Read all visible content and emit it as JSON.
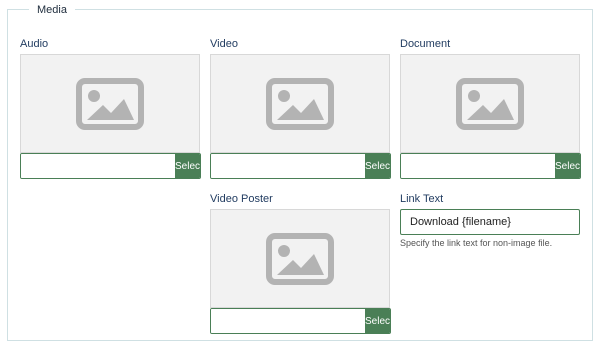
{
  "fieldset": {
    "legend": "Media"
  },
  "fields": {
    "audio": {
      "label": "Audio",
      "value": "",
      "button": "Select",
      "preview_icon": "image-placeholder-icon"
    },
    "video": {
      "label": "Video",
      "value": "",
      "button": "Select",
      "preview_icon": "image-placeholder-icon"
    },
    "document": {
      "label": "Document",
      "value": "",
      "button": "Select",
      "preview_icon": "image-placeholder-icon"
    },
    "video_poster": {
      "label": "Video Poster",
      "value": "",
      "button": "Select",
      "preview_icon": "image-placeholder-icon"
    },
    "link_text": {
      "label": "Link Text",
      "value": "Download {filename}",
      "help": "Specify the link text for non-image file."
    }
  },
  "colors": {
    "accent": "#4a7f56",
    "fieldset_border": "#cfe0e3",
    "preview_bg": "#f2f2f2",
    "icon": "#b3b3b3",
    "label": "#1f3a5f"
  }
}
